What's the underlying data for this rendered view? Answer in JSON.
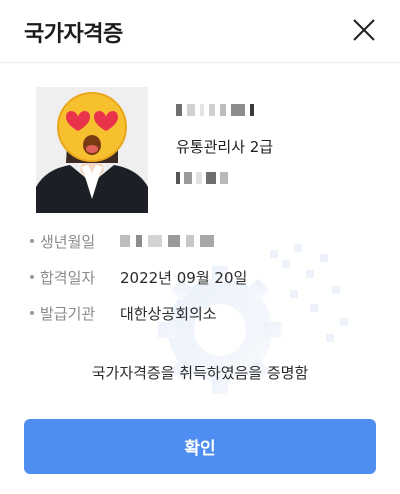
{
  "modal": {
    "title": "국가자격증",
    "close_icon": "close-icon"
  },
  "certificate": {
    "photo_icon": "heart-eyes-emoji-icon",
    "holder_name": "",
    "name": "유통관리사 2급",
    "cert_number": ""
  },
  "details": {
    "birth_label": "생년월일",
    "birth_value": "",
    "pass_date_label": "합격일자",
    "pass_date_value": "2022년 09월 20일",
    "issuer_label": "발급기관",
    "issuer_value": "대한상공회의소"
  },
  "notice": "국가자격증을 취득하였음을 증명함",
  "confirm_button": "확인",
  "colors": {
    "accent": "#4d8ef0",
    "label_gray": "#8a8a8a",
    "watermark": "#eef3fb"
  }
}
